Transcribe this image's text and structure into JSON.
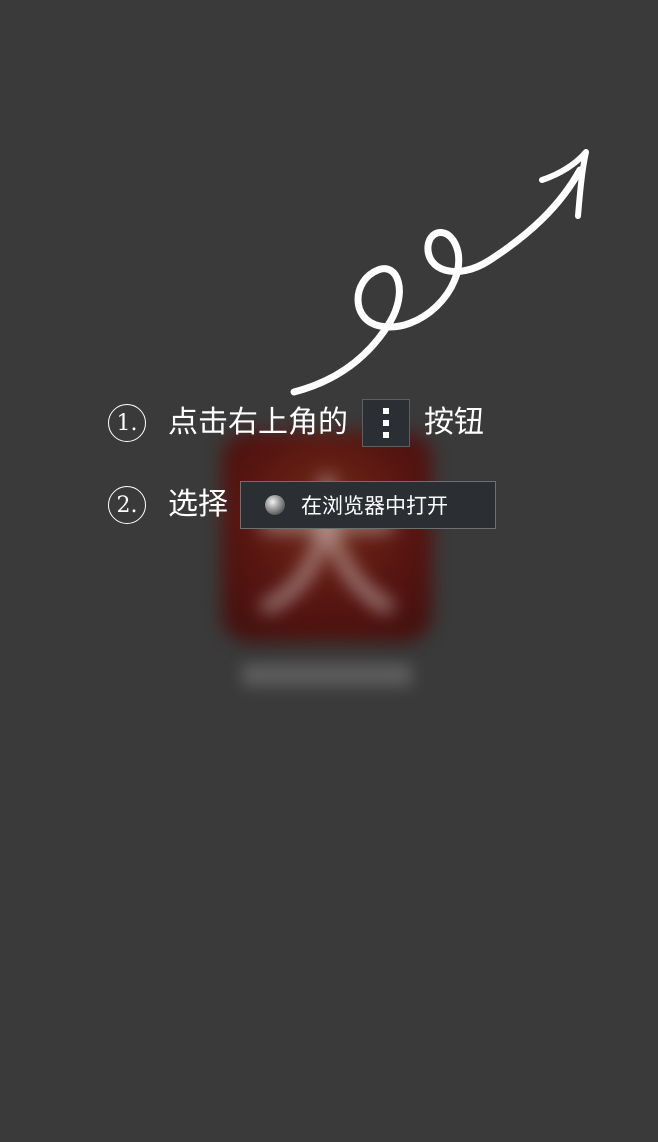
{
  "steps": [
    {
      "number": "1.",
      "text_before": "点击右上角的",
      "text_after": "按钮"
    },
    {
      "number": "2.",
      "text_before": "选择",
      "button_label": "在浏览器中打开"
    }
  ],
  "icons": {
    "menu": "more-vertical-icon",
    "browser": "globe-icon",
    "pointer": "curly-arrow-icon"
  },
  "colors": {
    "background": "#3a3a3a",
    "button_bg": "#2b2f33",
    "text": "#ffffff"
  }
}
